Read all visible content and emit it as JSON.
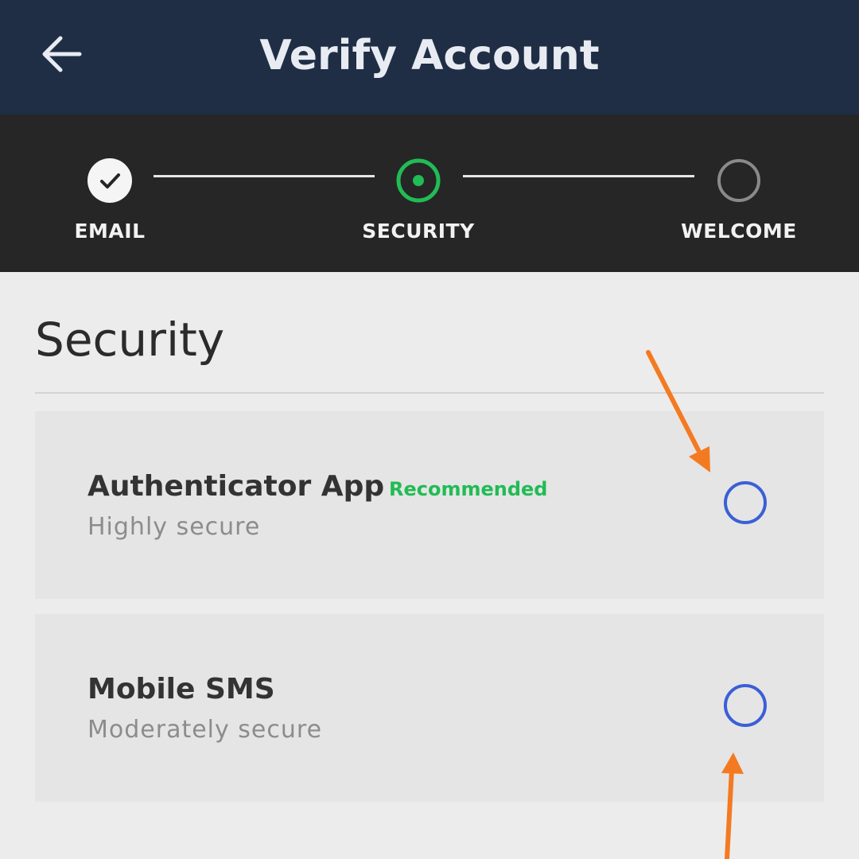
{
  "header": {
    "title": "Verify Account",
    "back_icon": "arrow-left-icon"
  },
  "stepper": {
    "steps": [
      {
        "label": "EMAIL",
        "state": "completed",
        "icon": "check-icon"
      },
      {
        "label": "SECURITY",
        "state": "current",
        "icon": "radio-dot-icon"
      },
      {
        "label": "WELCOME",
        "state": "upcoming",
        "icon": "empty-circle-icon"
      }
    ]
  },
  "content": {
    "title": "Security",
    "options": [
      {
        "title": "Authenticator App",
        "badge": "Recommended",
        "subtitle": "Highly secure",
        "selected": false
      },
      {
        "title": "Mobile SMS",
        "badge": "",
        "subtitle": "Moderately secure",
        "selected": false
      }
    ]
  },
  "colors": {
    "header_bg": "#1f2e45",
    "stepper_bg": "#262626",
    "accent_green": "#22bb55",
    "radio_blue": "#3b5fd6",
    "annotation_orange": "#f47a21"
  }
}
